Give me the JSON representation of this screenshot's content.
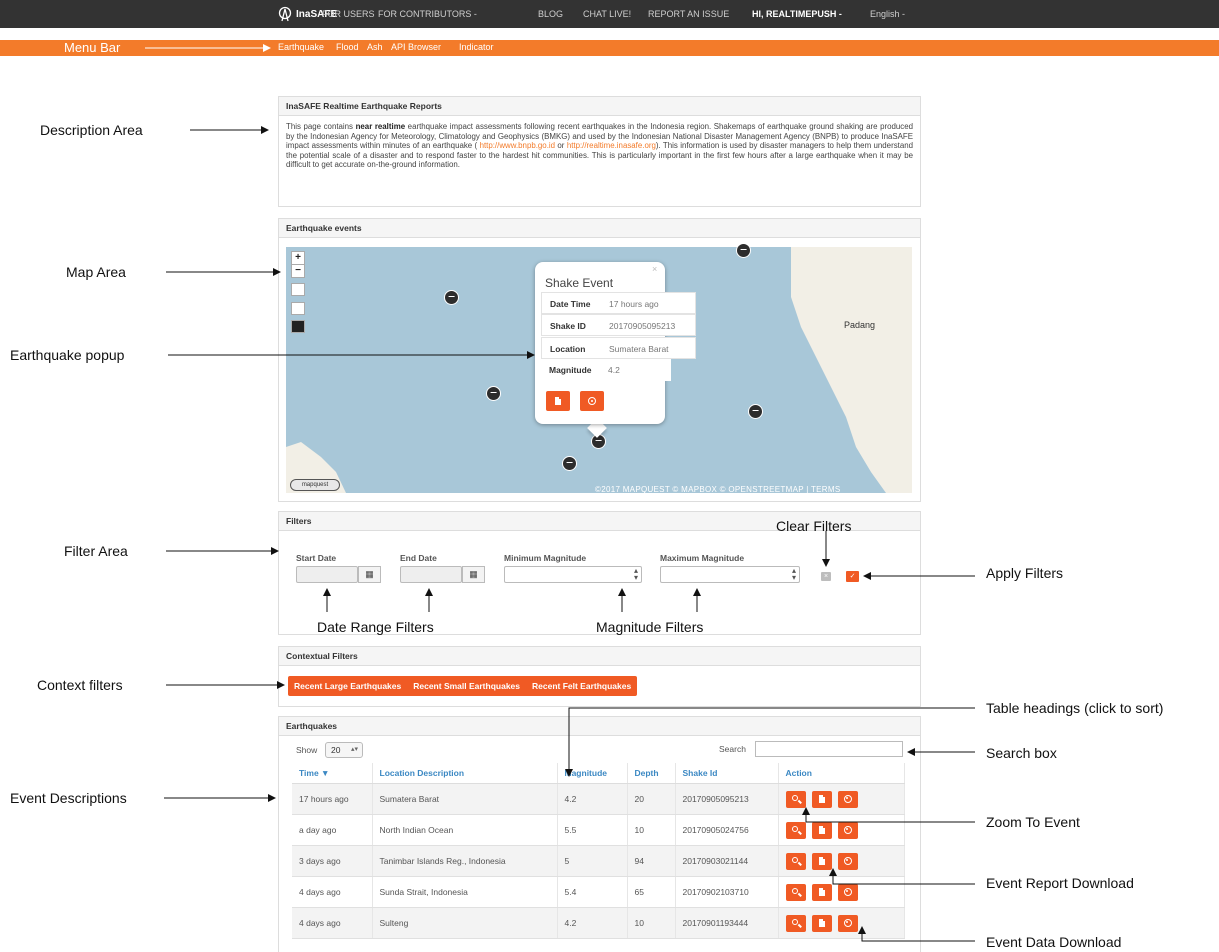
{
  "nav": {
    "brand": "InaSAFE",
    "items": [
      "FOR USERS",
      "FOR CONTRIBUTORS -",
      "BLOG",
      "CHAT LIVE!",
      "REPORT AN ISSUE"
    ],
    "user": "HI, REALTIMEPUSH -",
    "language": "English -"
  },
  "submenu": {
    "items": [
      "Earthquake",
      "Flood",
      "Ash",
      "API Browser",
      "Indicator"
    ]
  },
  "description": {
    "title": "InaSAFE Realtime Earthquake Reports",
    "text_before": "This page contains ",
    "text_bold": "near realtime",
    "text_middle": " earthquake impact assessments following recent earthquakes in the Indonesia region. Shakemaps of earthquake ground shaking are produced by the Indonesian Agency for Meteorology, Climatology and Geophysics (BMKG) and used by the Indonesian National Disaster Management Agency (BNPB) to produce InaSAFE impact assessments within minutes of an earthquake ( ",
    "link1": "http://www.bnpb.go.id",
    "text_or": " or ",
    "link2": "http://realtime.inasafe.org",
    "text_after": "). This information is used by disaster managers to help them understand the potential scale of a disaster and to respond faster to the hardest hit communities. This is particularly important in the first few hours after a large earthquake when it may be difficult to get accurate on-the-ground information."
  },
  "map": {
    "title": "Earthquake events",
    "zoom_in": "+",
    "zoom_out": "−",
    "place_label": "Padang",
    "attribution": "©2017 MAPQUEST © MAPBOX © OPENSTREETMAP | TERMS",
    "logo": "mapquest",
    "popup": {
      "close": "×",
      "title": "Shake Event",
      "rows": [
        {
          "key": "Date Time",
          "value": "17 hours ago"
        },
        {
          "key": "Shake ID",
          "value": "20170905095213"
        },
        {
          "key": "Location",
          "value": "Sumatera Barat"
        },
        {
          "key": "Magnitude",
          "value": "4.2"
        }
      ]
    }
  },
  "filters": {
    "title": "Filters",
    "start_date": "Start Date",
    "end_date": "End Date",
    "min_magnitude": "Minimum Magnitude",
    "max_magnitude": "Maximum Magnitude",
    "calendar_icon": "calendar-icon",
    "clear_symbol": "×",
    "apply_symbol": "✓"
  },
  "context": {
    "title": "Contextual Filters",
    "buttons": [
      "Recent Large Earthquakes",
      "Recent Small Earthquakes",
      "Recent Felt Earthquakes"
    ]
  },
  "table": {
    "title": "Earthquakes",
    "show_label": "Show",
    "show_value": "20",
    "search_label": "Search",
    "headers": [
      "Time ▼",
      "Location Description",
      "Magnitude",
      "Depth",
      "Shake Id",
      "Action"
    ],
    "rows": [
      {
        "time": "17 hours ago",
        "location": "Sumatera Barat",
        "magnitude": "4.2",
        "depth": "20",
        "shake_id": "20170905095213"
      },
      {
        "time": "a day ago",
        "location": "North Indian Ocean",
        "magnitude": "5.5",
        "depth": "10",
        "shake_id": "20170905024756"
      },
      {
        "time": "3 days ago",
        "location": "Tanimbar Islands Reg., Indonesia",
        "magnitude": "5",
        "depth": "94",
        "shake_id": "20170903021144"
      },
      {
        "time": "4 days ago",
        "location": "Sunda Strait, Indonesia",
        "magnitude": "5.4",
        "depth": "65",
        "shake_id": "20170902103710"
      },
      {
        "time": "4 days ago",
        "location": "Sulteng",
        "magnitude": "4.2",
        "depth": "10",
        "shake_id": "20170901193444"
      }
    ]
  },
  "annotations": {
    "menu_bar": "Menu Bar",
    "description_area": "Description Area",
    "map_area": "Map Area",
    "earthquake_popup": "Earthquake popup",
    "filter_area": "Filter Area",
    "clear_filters": "Clear Filters",
    "apply_filters": "Apply Filters",
    "date_range_filters": "Date Range Filters",
    "magnitude_filters": "Magnitude Filters",
    "context_filters": "Context filters",
    "table_headings": "Table headings (click to sort)",
    "search_box": "Search box",
    "event_descriptions": "Event Descriptions",
    "zoom_to_event": "Zoom To Event",
    "event_report_download": "Event Report Download",
    "event_data_download": "Event Data Download"
  },
  "colors": {
    "accent": "#f05a24",
    "menubar": "#f37b2a",
    "topbar": "#333333",
    "header_link": "#3b88c3",
    "map_water": "#a8c7d8"
  }
}
